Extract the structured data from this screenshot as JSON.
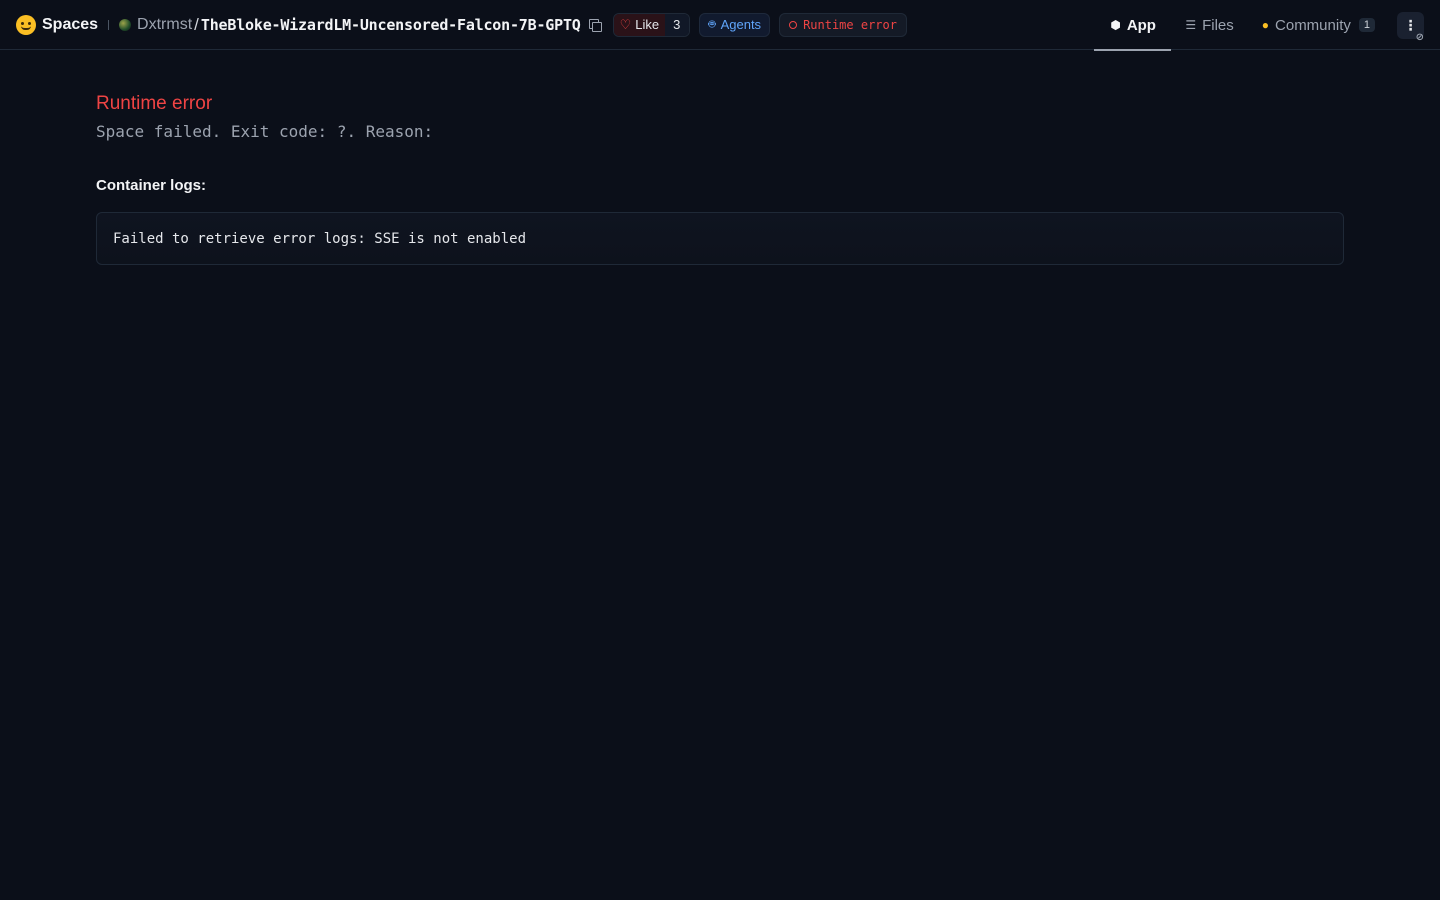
{
  "header": {
    "brand": "Spaces",
    "owner": "Dxtrmst",
    "separator": "/",
    "repo": "TheBloke-WizardLM-Uncensored-Falcon-7B-GPTQ",
    "like_label": "Like",
    "like_count": "3",
    "agents_label": "Agents",
    "status_label": "Runtime error"
  },
  "tabs": [
    {
      "label": "App",
      "icon": "cube-icon",
      "active": true
    },
    {
      "label": "Files",
      "icon": "files-icon"
    },
    {
      "label": "Community",
      "icon": "community-icon",
      "badge": "1"
    }
  ],
  "more_label": "⋮",
  "main": {
    "error_title": "Runtime error",
    "error_reason": "Space failed. Exit code: ?. Reason:",
    "logs_label": "Container logs:",
    "logs_text": "Failed to retrieve error logs: SSE is not enabled"
  },
  "colors": {
    "background": "#0b0f19",
    "error": "#ef4444",
    "agents": "#60a5fa"
  }
}
